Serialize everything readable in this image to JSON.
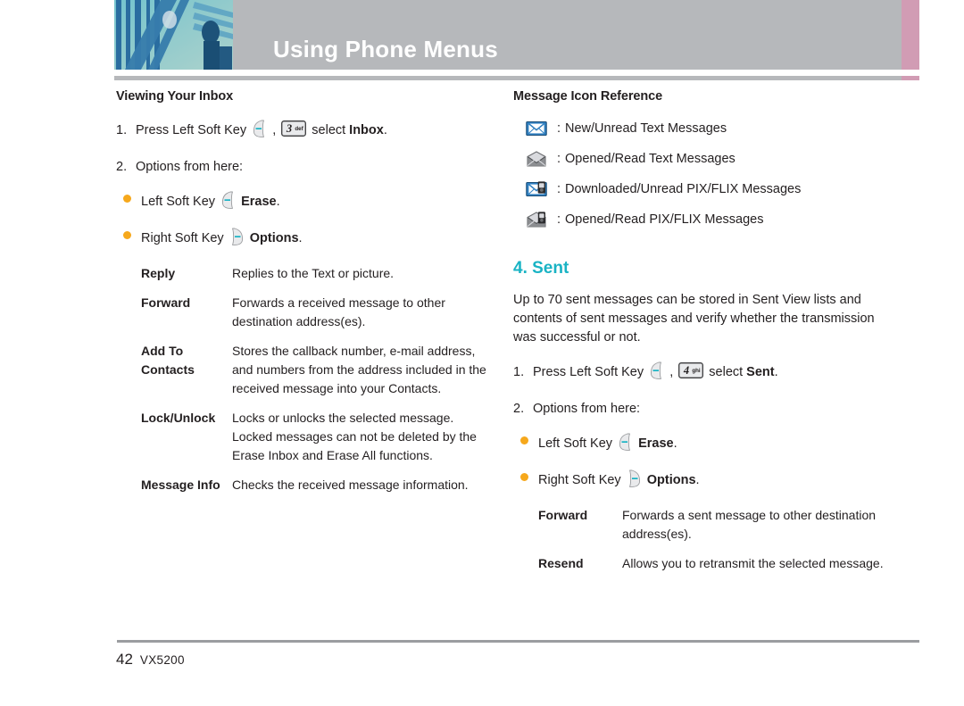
{
  "header": {
    "title": "Using Phone Menus",
    "photo_alt": "stylized-blue-architecture-photo",
    "band_color": "#b6b8bb",
    "accent_color": "#d19cb4"
  },
  "left_column": {
    "section_title": "Viewing Your Inbox",
    "steps": [
      {
        "num": "1.",
        "pre": "Press Left Soft Key",
        "icon1": "left-soft-key-icon",
        "comma": ",",
        "icon2": "number-key-3-def",
        "mid": "select",
        "bold": "Inbox",
        "post": "."
      },
      {
        "num": "2.",
        "pre": "Options from here:",
        "icon1": "",
        "comma": "",
        "icon2": "",
        "mid": "",
        "bold": "",
        "post": ""
      }
    ],
    "bullets": [
      {
        "pre": "Left Soft Key",
        "icon": "left-soft-key-icon",
        "bold": "Erase",
        "post": "."
      },
      {
        "pre": "Right Soft Key",
        "icon": "right-soft-key-icon",
        "bold": "Options",
        "post": "."
      }
    ],
    "options": [
      {
        "term": "Reply",
        "desc": "Replies to the Text or picture."
      },
      {
        "term": "Forward",
        "desc": "Forwards a received message to other destination address(es)."
      },
      {
        "term": "Add To Contacts",
        "desc": "Stores the callback number, e-mail address, and numbers from the address included in the received message into your Contacts."
      },
      {
        "term": "Lock/Unlock",
        "desc": "Locks or unlocks the selected message. Locked messages can not be deleted by the Erase Inbox and Erase All functions."
      },
      {
        "term": "Message Info",
        "desc": "Checks the received message information."
      }
    ]
  },
  "right_column": {
    "section_title": "Message Icon Reference",
    "icon_items": [
      {
        "icon": "new-unread-text-message-icon",
        "colon": ":",
        "label": "New/Unread Text Messages"
      },
      {
        "icon": "opened-read-text-message-icon",
        "colon": ":",
        "label": "Opened/Read Text Messages"
      },
      {
        "icon": "downloaded-unread-pixflix-message-icon",
        "colon": ":",
        "label": "Downloaded/Unread PIX/FLIX Messages"
      },
      {
        "icon": "opened-read-pixflix-message-icon",
        "colon": ":",
        "label": "Opened/Read PIX/FLIX Messages"
      }
    ],
    "sent_heading": "4. Sent",
    "sent_heading_color": "#19b3c4",
    "sent_paragraph": "Up to 70 sent messages can be stored in Sent View lists and contents of sent messages and verify whether the transmission was successful or not.",
    "steps": [
      {
        "num": "1.",
        "pre": "Press Left Soft Key",
        "icon1": "left-soft-key-icon",
        "comma": ",",
        "icon2": "number-key-4-ghi",
        "mid": "select",
        "bold": "Sent",
        "post": "."
      },
      {
        "num": "2.",
        "pre": "Options from here:",
        "icon1": "",
        "comma": "",
        "icon2": "",
        "mid": "",
        "bold": "",
        "post": ""
      }
    ],
    "bullets": [
      {
        "pre": "Left Soft Key",
        "icon": "left-soft-key-icon",
        "bold": "Erase",
        "post": "."
      },
      {
        "pre": "Right Soft Key",
        "icon": "right-soft-key-icon",
        "bold": "Options",
        "post": "."
      }
    ],
    "options": [
      {
        "term": "Forward",
        "desc": "Forwards a sent message to other destination address(es)."
      },
      {
        "term": "Resend",
        "desc": "Allows you to retransmit the selected message."
      }
    ]
  },
  "keys": {
    "key3_digit": "3",
    "key3_letters": "def",
    "key4_digit": "4",
    "key4_letters": "ghi"
  },
  "footer": {
    "page_number": "42",
    "model": "VX5200"
  }
}
